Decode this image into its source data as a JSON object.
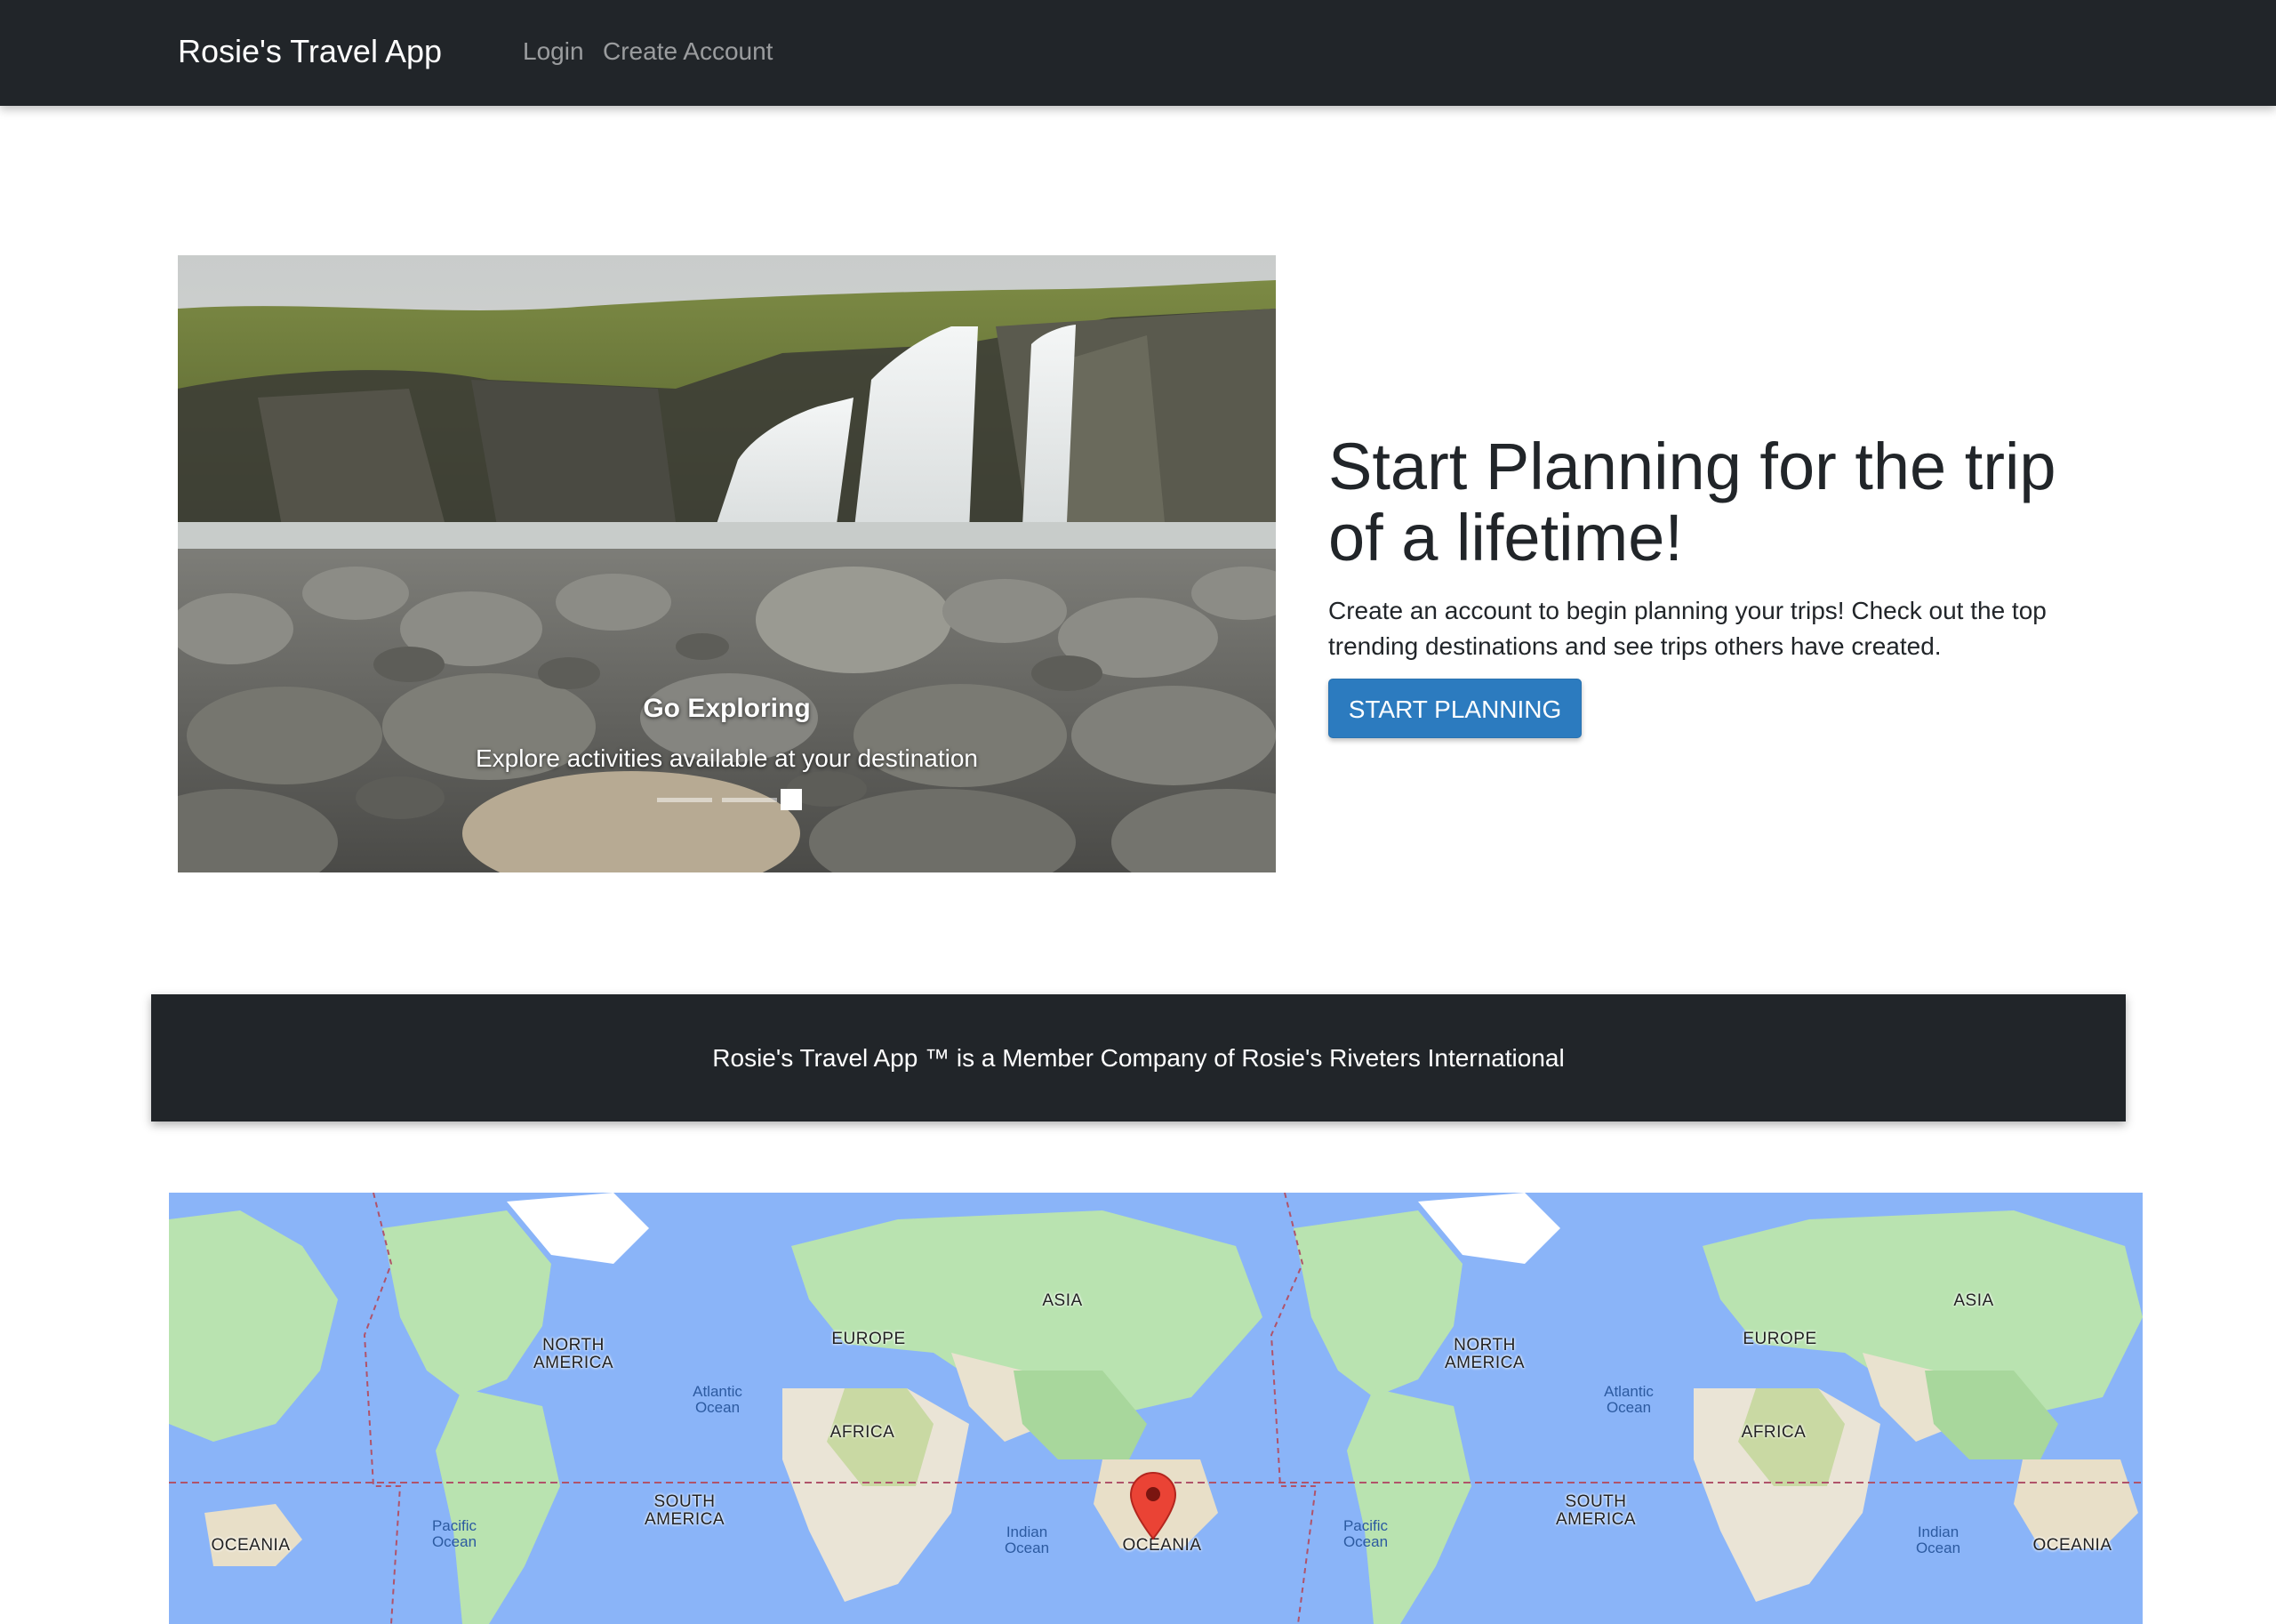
{
  "navbar": {
    "brand": "Rosie's Travel App",
    "links": [
      {
        "label": "Login"
      },
      {
        "label": "Create Account"
      }
    ]
  },
  "hero": {
    "carousel": {
      "caption_title": "Go Exploring",
      "caption_text": "Explore activities available at your destination",
      "slide_count": 3,
      "active_slide": 3
    },
    "title": "Start Planning for the trip of a lifetime!",
    "description": "Create an account to begin planning your trips! Check out the top trending destinations and see trips others have created.",
    "cta_label": "START PLANNING",
    "cta_color": "#2c7bbf"
  },
  "banner": {
    "text": "Rosie's Travel App ™ is a Member Company of Rosie's Riveters International"
  },
  "map": {
    "continent_labels": [
      "NORTH\nAMERICA",
      "EUROPE",
      "ASIA",
      "AFRICA",
      "SOUTH\nAMERICA",
      "OCEANIA",
      "OCEANIA",
      "NORTH\nAMERICA",
      "EUROPE",
      "ASIA",
      "AFRICA",
      "SOUTH\nAMERICA",
      "OCEANIA"
    ],
    "ocean_labels": [
      "Atlantic\nOcean",
      "Pacific\nOcean",
      "Indian\nOcean",
      "Atlantic\nOcean",
      "Pacific\nOcean",
      "Indian\nOcean"
    ],
    "marker": "map-pin-icon",
    "water_color": "#8ab4f8",
    "land_color": "#b9e3b0"
  }
}
